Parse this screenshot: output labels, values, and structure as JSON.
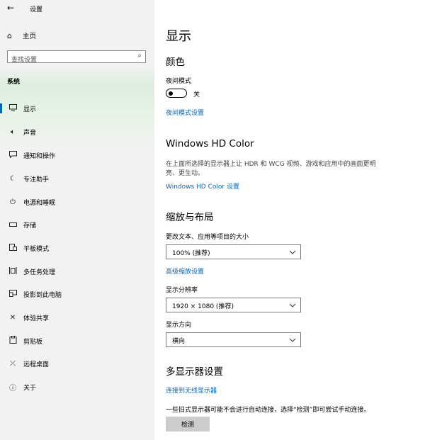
{
  "window": {
    "back_icon": "back-arrow-icon",
    "title": "设置"
  },
  "sidebar": {
    "home_label": "主页",
    "search_placeholder": "查找设置",
    "section_label": "系统",
    "items": [
      {
        "icon": "monitor-icon",
        "label": "显示",
        "active": true
      },
      {
        "icon": "speaker-icon",
        "label": "声音"
      },
      {
        "icon": "notification-icon",
        "label": "通知和操作"
      },
      {
        "icon": "moon-icon",
        "label": "专注助手"
      },
      {
        "icon": "power-icon",
        "label": "电源和睡眠"
      },
      {
        "icon": "storage-icon",
        "label": "存储"
      },
      {
        "icon": "tablet-icon",
        "label": "平板模式"
      },
      {
        "icon": "multitask-icon",
        "label": "多任务处理"
      },
      {
        "icon": "project-icon",
        "label": "投影到此电脑"
      },
      {
        "icon": "share-icon",
        "label": "体验共享"
      },
      {
        "icon": "clipboard-icon",
        "label": "剪贴板"
      },
      {
        "icon": "remote-icon",
        "label": "远程桌面"
      },
      {
        "icon": "info-icon",
        "label": "关于"
      }
    ]
  },
  "main": {
    "page_title": "显示",
    "color": {
      "heading": "颜色",
      "night_mode_label": "夜间模式",
      "night_mode_state": "关",
      "night_mode_link": "夜间模式设置"
    },
    "hdr": {
      "heading": "Windows HD Color",
      "description": "在上面所选择的显示器上让 HDR 和 WCG 视频、游戏和应用中的画面更明亮、更生动。",
      "link": "Windows HD Color 设置"
    },
    "scale": {
      "heading": "缩放与布局",
      "size_label": "更改文本、应用等项目的大小",
      "size_value": "100% (推荐)",
      "advanced_link": "高级缩放设置",
      "resolution_label": "显示分辨率",
      "resolution_value": "1920 × 1080 (推荐)",
      "orientation_label": "显示方向",
      "orientation_value": "横向"
    },
    "multi": {
      "heading": "多显示器设置",
      "wireless_link": "连接到无线显示器",
      "note": "一些旧式显示器可能不会进行自动连接，选择“检测”即可尝试手动连接。",
      "detect_button": "检测"
    }
  }
}
